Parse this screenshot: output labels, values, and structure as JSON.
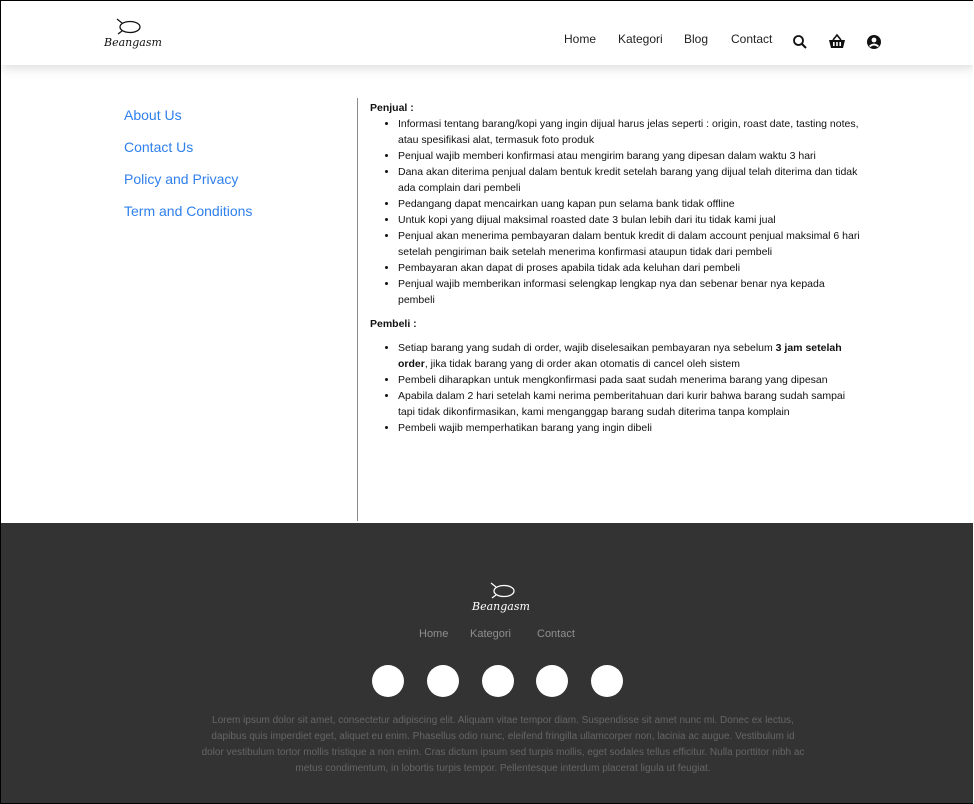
{
  "header": {
    "logo_text": "Beangasm",
    "nav": [
      "Home",
      "Kategori",
      "Blog",
      "Contact"
    ],
    "icons": [
      "search-icon",
      "basket-icon",
      "user-circle-icon"
    ]
  },
  "sidebar": {
    "links": [
      "About Us",
      "Contact Us",
      "Policy and Privacy",
      "Term and Conditions"
    ]
  },
  "content": {
    "penjual_title": "Penjual :",
    "penjual_items": [
      "Informasi tentang barang/kopi yang ingin dijual harus jelas seperti : origin, roast date, tasting notes, atau spesifikasi alat, termasuk foto produk",
      "Penjual wajib memberi konfirmasi atau mengirim barang yang dipesan dalam waktu 3 hari",
      "Dana akan diterima penjual dalam bentuk kredit setelah barang yang dijual telah diterima dan tidak ada complain dari pembeli",
      "Pedangang dapat mencairkan uang kapan pun selama bank tidak offline",
      "Untuk kopi yang dijual maksimal roasted date 3 bulan lebih dari itu tidak kami jual",
      "Penjual akan menerima pembayaran dalam bentuk kredit di dalam account penjual maksimal 6 hari setelah pengiriman baik setelah menerima konfirmasi ataupun tidak dari pembeli",
      "Pembayaran akan dapat di proses apabila tidak ada keluhan dari pembeli",
      "Penjual wajib memberikan informasi selengkap lengkap nya dan sebenar benar nya kepada pembeli"
    ],
    "pembeli_title": "Pembeli :",
    "pembeli_first": {
      "before": "Setiap barang yang sudah di order, wajib diselesaikan pembayaran nya sebelum ",
      "bold": "3 jam setelah order",
      "after": ", jika tidak barang yang di order akan otomatis di cancel oleh sistem"
    },
    "pembeli_items": [
      "Pembeli diharapkan untuk mengkonfirmasi pada saat sudah menerima barang yang dipesan",
      "Apabila dalam 2 hari setelah kami nerima pemberitahuan dari kurir bahwa barang sudah sampai tapi tidak dikonfirmasikan, kami menganggap barang sudah diterima tanpa komplain",
      "Pembeli wajib memperhatikan barang yang ingin dibeli"
    ]
  },
  "footer": {
    "logo_text": "Beangasm",
    "nav": [
      "Home",
      "Kategori",
      "Contact"
    ],
    "social_count": 5,
    "lorem": "Lorem ipsum dolor sit amet, consectetur adipiscing elit. Aliquam vitae tempor diam. Suspendisse sit amet nunc mi. Donec ex lectus, dapibus quis imperdiet eget, aliquet eu enim. Phasellus odio nunc, eleifend fringilla ullamcorper non, lacinia ac augue. Vestibulum id dolor vestibulum tortor mollis tristique a non enim. Cras dictum ipsum sed turpis mollis, eget sodales tellus efficitur. Nulla porttitor nibh ac metus condimentum, in lobortis turpis tempor. Pellentesque interdum placerat ligula ut feugiat."
  },
  "colors": {
    "link": "#2f80ed",
    "footer_bg": "#333333",
    "footer_text": "#666666",
    "footer_nav": "#8f8f8f"
  }
}
